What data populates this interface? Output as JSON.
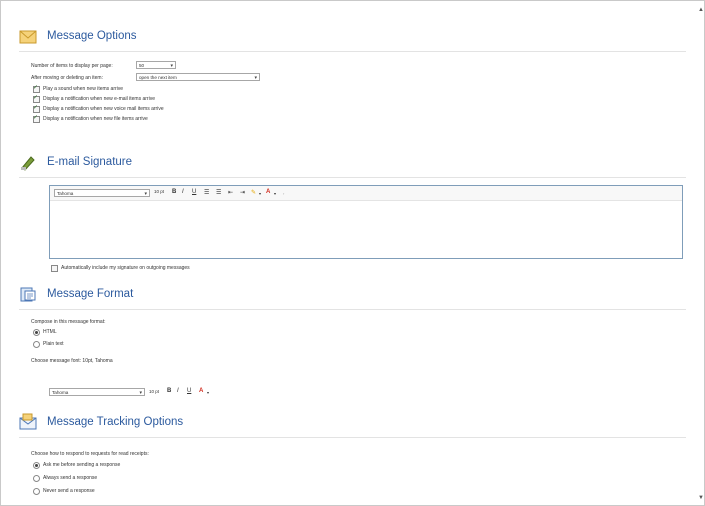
{
  "sections": {
    "message_options": {
      "title": "Message Options",
      "items_per_page_label": "Number of items to display per page:",
      "items_per_page_value": "50",
      "after_moving_label": "After moving or deleting an item:",
      "after_moving_value": "open the next item",
      "checkboxes": [
        {
          "label": "Play a sound when new items arrive",
          "checked": true
        },
        {
          "label": "Display a notification when new e-mail items arrive",
          "checked": true
        },
        {
          "label": "Display a notification when new voice mail items arrive",
          "checked": true
        },
        {
          "label": "Display a notification when new file items arrive",
          "checked": true
        }
      ]
    },
    "email_signature": {
      "title": "E-mail Signature",
      "font_value": "Tahoma",
      "font_size": "10 pt",
      "auto_include_label": "Automatically include my signature on outgoing messages",
      "auto_include_checked": false
    },
    "message_format": {
      "title": "Message Format",
      "compose_label": "Compose in this message format:",
      "html_label": "HTML",
      "plain_label": "Plain text",
      "html_selected": true,
      "font_label": "Choose message font: 10pt, Tahoma",
      "font_value": "Tahoma",
      "font_size": "10 pt"
    },
    "tracking": {
      "title": "Message Tracking Options",
      "respond_label": "Choose how to respond to requests for read receipts:",
      "options": [
        {
          "label": "Ask me before sending a response",
          "selected": true
        },
        {
          "label": "Always send a response",
          "selected": false
        },
        {
          "label": "Never send a response",
          "selected": false
        }
      ]
    }
  },
  "toolbar_glyphs": {
    "bold": "B",
    "italic": "I",
    "underline": "U",
    "font_color": "A"
  },
  "colors": {
    "title": "#2c5a9e",
    "editor_border": "#7f9db9",
    "font_color_red": "#d12a1c"
  }
}
